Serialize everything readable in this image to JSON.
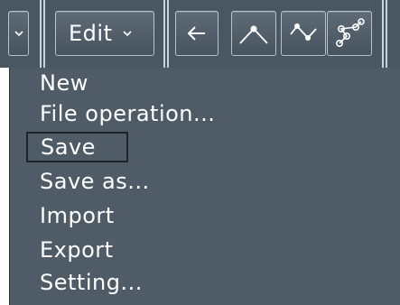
{
  "toolbar": {
    "dropdown_icon": "caret-down-icon",
    "edit_label": "Edit",
    "edit_icon": "caret-down-icon",
    "back_icon": "arrow-left-icon",
    "tool_icons": [
      "peak-line-tool-icon",
      "zigzag-line-tool-icon",
      "multi-point-route-tool-icon"
    ]
  },
  "menu": {
    "items": [
      {
        "label": "New"
      },
      {
        "label": "File operation..."
      },
      {
        "label": "Save",
        "selected": true
      },
      {
        "label": "Save as..."
      },
      {
        "label": "Import"
      },
      {
        "label": "Export"
      },
      {
        "label": "Setting..."
      }
    ]
  },
  "colors": {
    "toolbar_bg": "#4a5763",
    "menu_bg": "#4f5c67",
    "text": "#ffffff",
    "selection_border": "#1e242a"
  }
}
